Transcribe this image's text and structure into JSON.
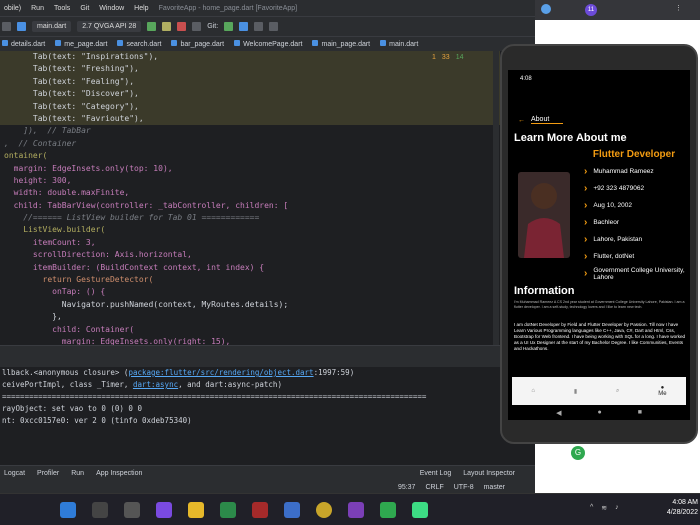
{
  "menu": {
    "items": [
      "Run",
      "Tools",
      "Git",
      "Window",
      "Help"
    ],
    "file_left": "obile)",
    "title_dim": "FavoriteApp - home_page.dart [FavoriteApp]"
  },
  "toolbar": {
    "main_dart": "main.dart",
    "device": "2.7  QVGA API 28",
    "git": "Git:"
  },
  "tabs": [
    "details.dart",
    "me_page.dart",
    "search.dart",
    "bar_page.dart",
    "WelcomePage.dart",
    "main_page.dart",
    "main.dart"
  ],
  "warnings": {
    "w1": "1",
    "w2": "33",
    "w3": "14"
  },
  "code": [
    {
      "t": "      Tab(text: \"Inspirations\"),"
    },
    {
      "t": "      Tab(text: \"Freshing\"),"
    },
    {
      "t": "      Tab(text: \"Fealing\"),"
    },
    {
      "t": "      Tab(text: \"Discover\"),"
    },
    {
      "t": "      Tab(text: \"Category\"),"
    },
    {
      "t": "      Tab(text: \"Favrioute\"),"
    },
    {
      "t": "    ]),  // TabBar"
    },
    {
      "t": ",  // Container"
    },
    {
      "t": "ontainer("
    },
    {
      "t": "  margin: EdgeInsets.only(top: 10),"
    },
    {
      "t": "  height: 300,"
    },
    {
      "t": "  width: double.maxFinite,"
    },
    {
      "t": "  child: TabBarView(controller: _tabController, children: ["
    },
    {
      "t": "    //====== ListView builder for Tab 01 ============"
    },
    {
      "t": "    ListView.builder("
    },
    {
      "t": "      itemCount: 3,"
    },
    {
      "t": "      scrollDirection: Axis.horizontal,"
    },
    {
      "t": "      itemBuilder: (BuildContext context, int index) {"
    },
    {
      "t": "        return GestureDetector("
    },
    {
      "t": "          onTap: () {"
    },
    {
      "t": "            Navigator.pushNamed(context, MyRoutes.details);"
    },
    {
      "t": "          },"
    },
    {
      "t": "          child: Container("
    },
    {
      "t": "            margin: EdgeInsets.only(right: 15),"
    }
  ],
  "console": {
    "l1a": "llback.<anonymous closure> (",
    "l1link": "package:flutter/src/rendering/object.dart",
    "l1b": ":1997:59)",
    "l2a": "ceivePortImpl, class _Timer, ",
    "l2link": "dart:async",
    "l2b": ", and dart:async-patch)",
    "l3": "==============================================================================================",
    "l4": "rayObject: set vao to 0 (0) 0 0",
    "l5": "nt: 0xcc0157e0: ver 2 0 (tinfo 0xdeb75340)"
  },
  "bottomtabs": [
    "Logcat",
    "Profiler",
    "Run",
    "App Inspection",
    "Event Log",
    "Layout Inspector"
  ],
  "status": {
    "pos": "95:37",
    "crlf": "CRLF",
    "enc": "UTF-8",
    "branch": "master"
  },
  "phone": {
    "time": "4:08",
    "about_tab": "About",
    "heading": "Learn More About me",
    "role": "Flutter Developer",
    "details": [
      "Muhammad Rameez",
      "+92 323 4879062",
      "Aug 10, 2002",
      "Bachleor",
      "Lahore, Pakistan",
      "Flutter, dotNet",
      "Government College University, Lahore"
    ],
    "info_title": "Information",
    "para1": "I'm Muhammad Rameez A CS 2nd year student at Government College University Lahore, Pakistan. I am a flutter developer. I am a self-study, technology lovers and I like to learn new tech.",
    "para2": "I am dotNet Developer by Field and Flutter Developer by Passion. Till now I have Learn Various Programming languages like C++, Java, C#, Dart and Html, Css, Bootstrap for Web frontend. I have being working with SQL for a long. I have worked as a UI Ux Designer at the start of my Bachelor Degree. I like Communities, Events and Hackathons.",
    "nav_me": "Me",
    "colors": {
      "accent": "#f39c12"
    }
  },
  "browser": {
    "badge": "11"
  },
  "clock": {
    "time": "4:08 AM",
    "date": "4/28/2022"
  }
}
